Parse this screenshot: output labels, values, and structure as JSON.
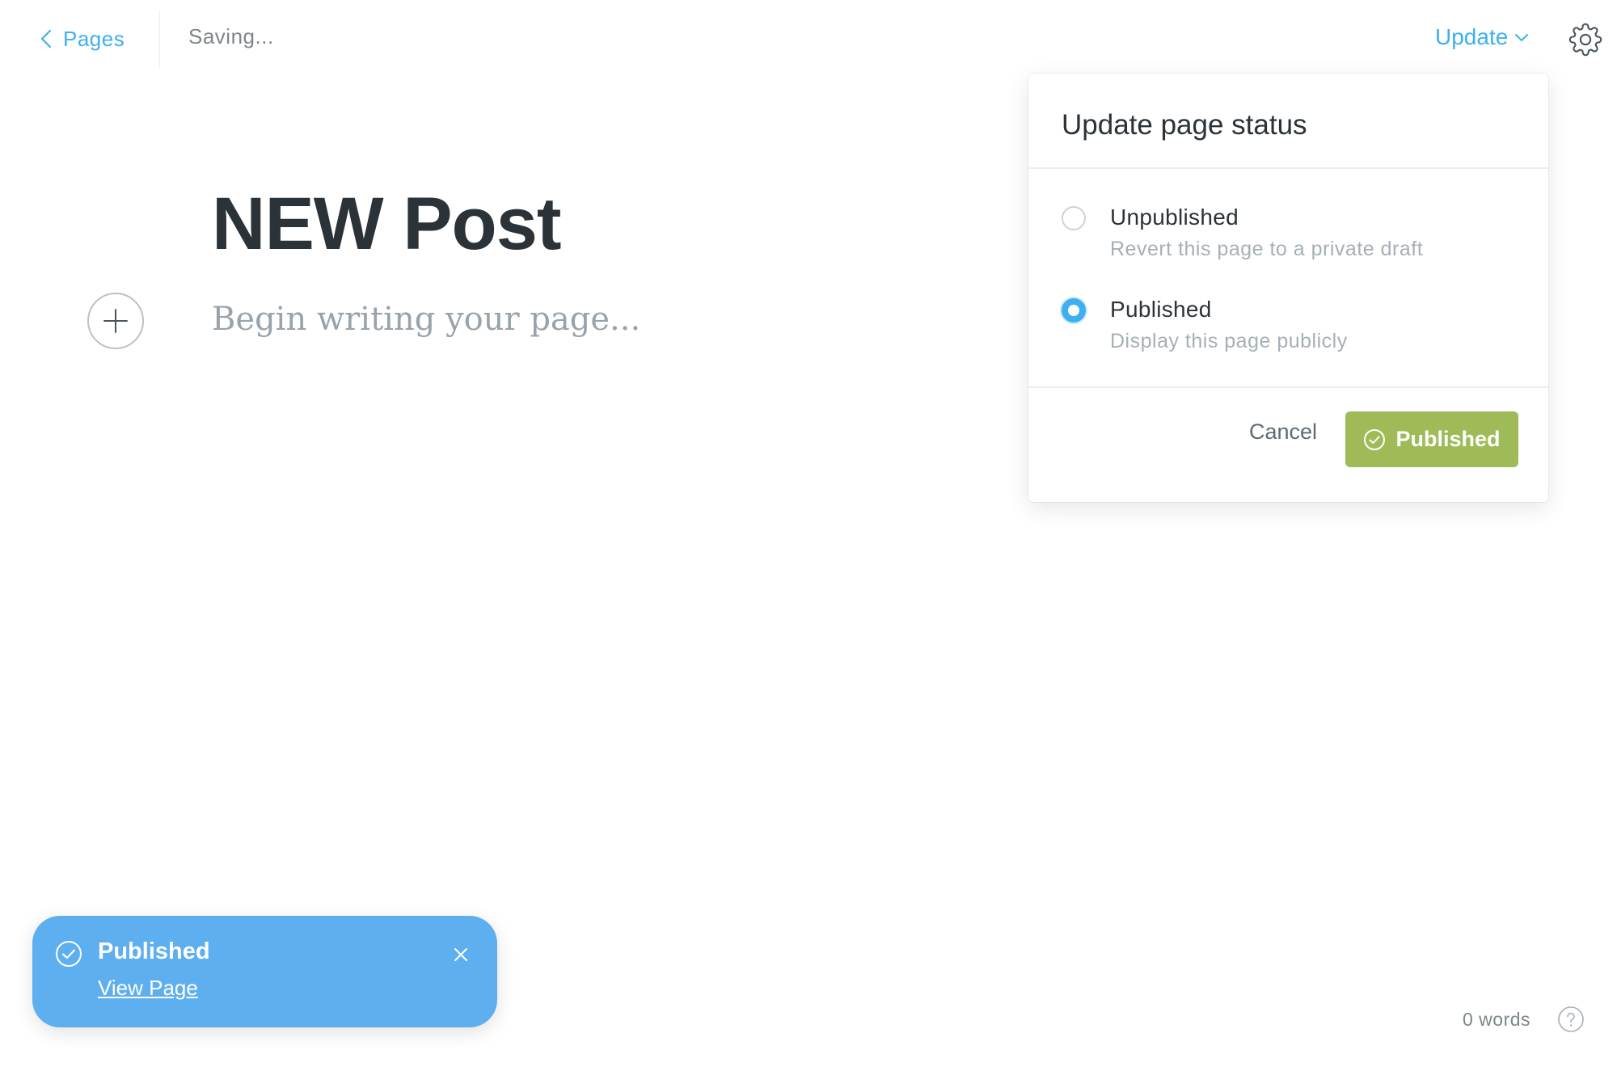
{
  "header": {
    "back_label": "Pages",
    "save_status": "Saving...",
    "update_label": "Update"
  },
  "editor": {
    "title": "NEW Post",
    "placeholder": "Begin writing your page..."
  },
  "status_popover": {
    "title": "Update page status",
    "options": [
      {
        "label": "Unpublished",
        "description": "Revert this page to a private draft",
        "selected": false
      },
      {
        "label": "Published",
        "description": "Display this page publicly",
        "selected": true
      }
    ],
    "cancel_label": "Cancel",
    "confirm_label": "Published"
  },
  "toast": {
    "title": "Published",
    "link_label": "View Page"
  },
  "footer": {
    "word_count": "0 words"
  },
  "colors": {
    "accent_blue": "#3eb0ef",
    "publish_green": "#9fbb58",
    "toast_blue": "#5eaff0",
    "title_dark": "#2b3338"
  },
  "icons": {
    "back": "chevron-left-icon",
    "update_caret": "chevron-down-icon",
    "settings": "gear-icon",
    "add_card": "plus-icon",
    "confirm": "check-circle-icon",
    "toast_status": "check-circle-icon",
    "toast_close": "close-icon",
    "help": "question-circle-icon"
  }
}
